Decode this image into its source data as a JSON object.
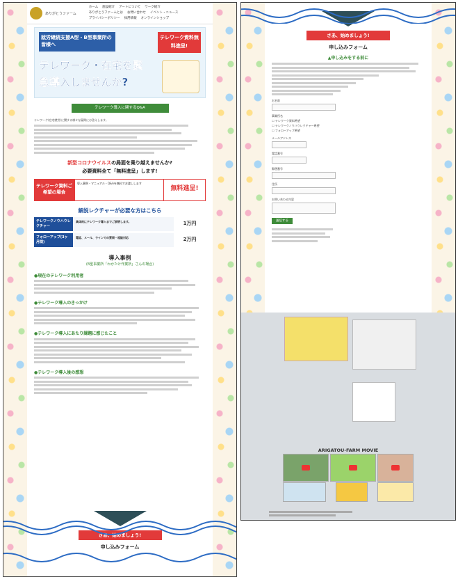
{
  "header": {
    "logo_text": "ありがとうファーム",
    "nav": [
      "ホーム",
      "施設紹介",
      "アートについて",
      "ワーク紹介",
      "ありがとうファームとは",
      "お問い合わせ",
      "イベント・ニュース",
      "プライバシーポリシー",
      "採用情報",
      "オンラインショップ"
    ]
  },
  "hero": {
    "bubble": "就労継続支援A型・B型事業所の皆様へ",
    "red_badge": "テレワーク資料無料進呈!",
    "headline": "テレワーク・在宅を緊急導入しませんか?"
  },
  "qa_button": "テレワーク導入に関するQ&A",
  "intro_text": "テレワーク(在宅就労)に関する様々な疑問にお答えします。",
  "corona": {
    "heading_pre": "新型コロナウイルス",
    "heading_post": "の局面を乗り越えませんか?",
    "subheading": "必要資料全て「無料進呈」します!",
    "promo_left": "テレワーク資料ご希望の場合",
    "promo_mid": "導入事例・マニュアル・Q&Aを無料でお渡しします",
    "promo_right": "無料進呈!"
  },
  "lecture": {
    "heading": "解説レクチャーが必要な方はこちら",
    "rows": [
      {
        "title": "テレワークノウハウレクチャー",
        "desc": "具体的にテレワーク導入までご説明します。",
        "price": "1万円"
      },
      {
        "title": "フォローアップ(3ヶ月間)",
        "desc": "電話、メール、ラインでの質問・相談対応",
        "price": "2万円"
      }
    ]
  },
  "case": {
    "heading": "導入事例",
    "sub": "(B型事業所「わかたけ作業所」さんの場合)",
    "s1": "●現在のテレワーク利用者",
    "s2": "●テレワーク導入のきっかけ",
    "s3": "●テレワーク導入にあたり課題に感じたこと",
    "s4": "●テレワーク導入後の感想"
  },
  "cta_banner": "さあ、始めましょう!",
  "form": {
    "title": "申し込みフォーム",
    "note_heading": "▲申し込みをする前に",
    "fields": [
      "お名前",
      "事業所名",
      "メールアドレス",
      "電話番号",
      "郵便番号",
      "住所",
      "お問い合わせ内容"
    ],
    "checks": [
      "テレワーク資料希望",
      "テレワークノウハウレクチャー希望",
      "フォローアップ希望"
    ],
    "submit": "送信する"
  },
  "movie": {
    "heading": "ARIGATOU-FARM MOVIE"
  },
  "colors": {
    "accent_red": "#e23a3a",
    "accent_green": "#3f8c3a",
    "accent_blue": "#1f4f9a"
  }
}
